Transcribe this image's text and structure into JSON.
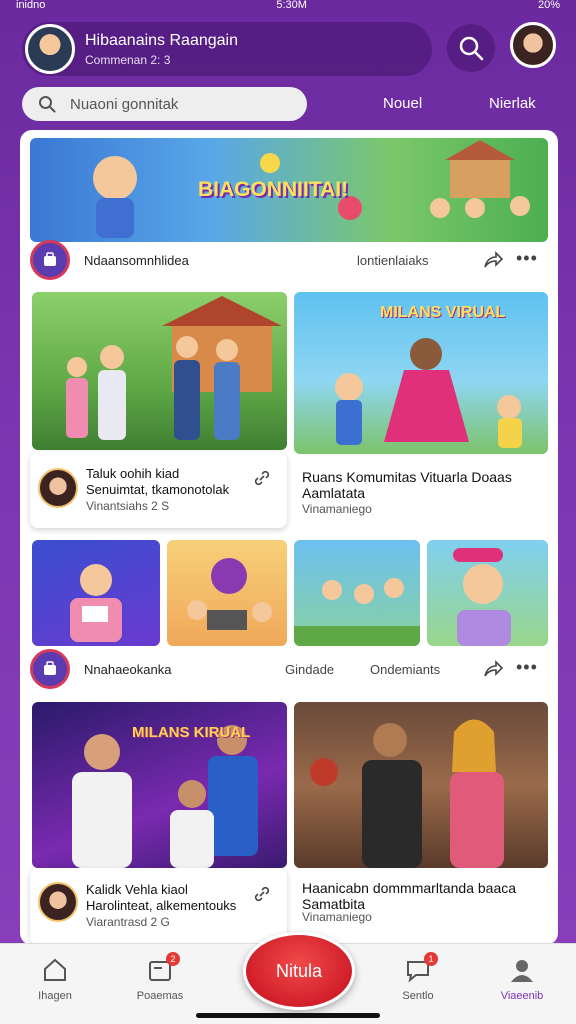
{
  "status_bar": {
    "left": "inidno",
    "center": "5:30M",
    "right": "20%"
  },
  "header": {
    "title": "Hibaanains Raangain",
    "subtitle": "Commenan 2: 3"
  },
  "search": {
    "placeholder": "Nuaoni gonnitak"
  },
  "top_tabs": [
    "Nouel",
    "Nierlak"
  ],
  "banner": {
    "title": "BIAGONNIITAI!"
  },
  "post1": {
    "name": "Ndaansomnhlidea",
    "right": "lontienlaiaks"
  },
  "grid1": {
    "left": {
      "title1": "Taluk oohih kiad",
      "title2": "Senuimtat, tkamonotolak",
      "sub": "Vinantsiahs 2 S"
    },
    "right": {
      "title": "Ruans Komumitas Vituarla Doaas Aamlatata",
      "sub": "Vinamaniego"
    },
    "right_image_text": "MILANS VIRUAL"
  },
  "post2": {
    "name": "Nnahaeokanka",
    "right1": "Gindade",
    "right2": "Ondemiants"
  },
  "grid2": {
    "left_image_text": "MILANS KIRUAL",
    "left": {
      "title1": "Kalidk Vehla kiaol",
      "title2": "Harolinteat, alkementouks",
      "sub": "Viarantrasd 2 G"
    },
    "right": {
      "title": "Haanicabn dommmarltanda baaca Samatbita",
      "sub": "Vinamaniego"
    }
  },
  "bottom_nav": [
    {
      "label": "Ihagen",
      "icon": "home-icon",
      "badge": ""
    },
    {
      "label": "Poaemas",
      "icon": "posts-icon",
      "badge": "2"
    },
    {
      "label": "Nitula",
      "icon": "create",
      "badge": ""
    },
    {
      "label": "Sentlo",
      "icon": "chat-icon",
      "badge": "1"
    },
    {
      "label": "Viaeenib",
      "icon": "profile-icon",
      "badge": ""
    }
  ],
  "colors": {
    "brand": "#7b35b0",
    "accent": "#d11f2a",
    "badge": "#e53935"
  }
}
